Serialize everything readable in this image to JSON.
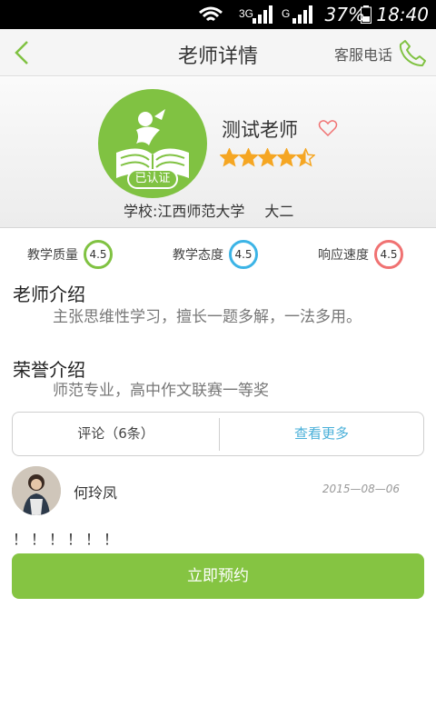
{
  "status_bar": {
    "signal1": "3G",
    "signal2": "G",
    "battery": "37%",
    "time": "18:40"
  },
  "nav": {
    "title": "老师详情",
    "service_label": "客服电话",
    "back_icon": "chevron-left-icon",
    "phone_icon": "phone-icon"
  },
  "profile": {
    "name": "测试老师",
    "verified_label": "已认证",
    "rating_stars": 4.5,
    "school_label": "学校:江西师范大学",
    "grade": "大二"
  },
  "ratings": [
    {
      "label": "教学质量",
      "value": "4.5",
      "color": "#80c242"
    },
    {
      "label": "教学态度",
      "value": "4.5",
      "color": "#3cb4e6"
    },
    {
      "label": "响应速度",
      "value": "4.5",
      "color": "#f07272"
    }
  ],
  "intro": {
    "title": "老师介绍",
    "body": "主张思维性学习，擅长一题多解，一法多用。"
  },
  "honors": {
    "title": "荣誉介绍",
    "body": "师范专业，高中作文联赛一等奖"
  },
  "tabs": {
    "comments": "评论（6条）",
    "more": "查看更多"
  },
  "comment": {
    "author": "何玲凤",
    "date": "2015—08—06",
    "text": "！！！！！！"
  },
  "book_button": "立即预约",
  "colors": {
    "accent": "#80c242",
    "link": "#4ab0d9",
    "star": "#f5a623"
  }
}
